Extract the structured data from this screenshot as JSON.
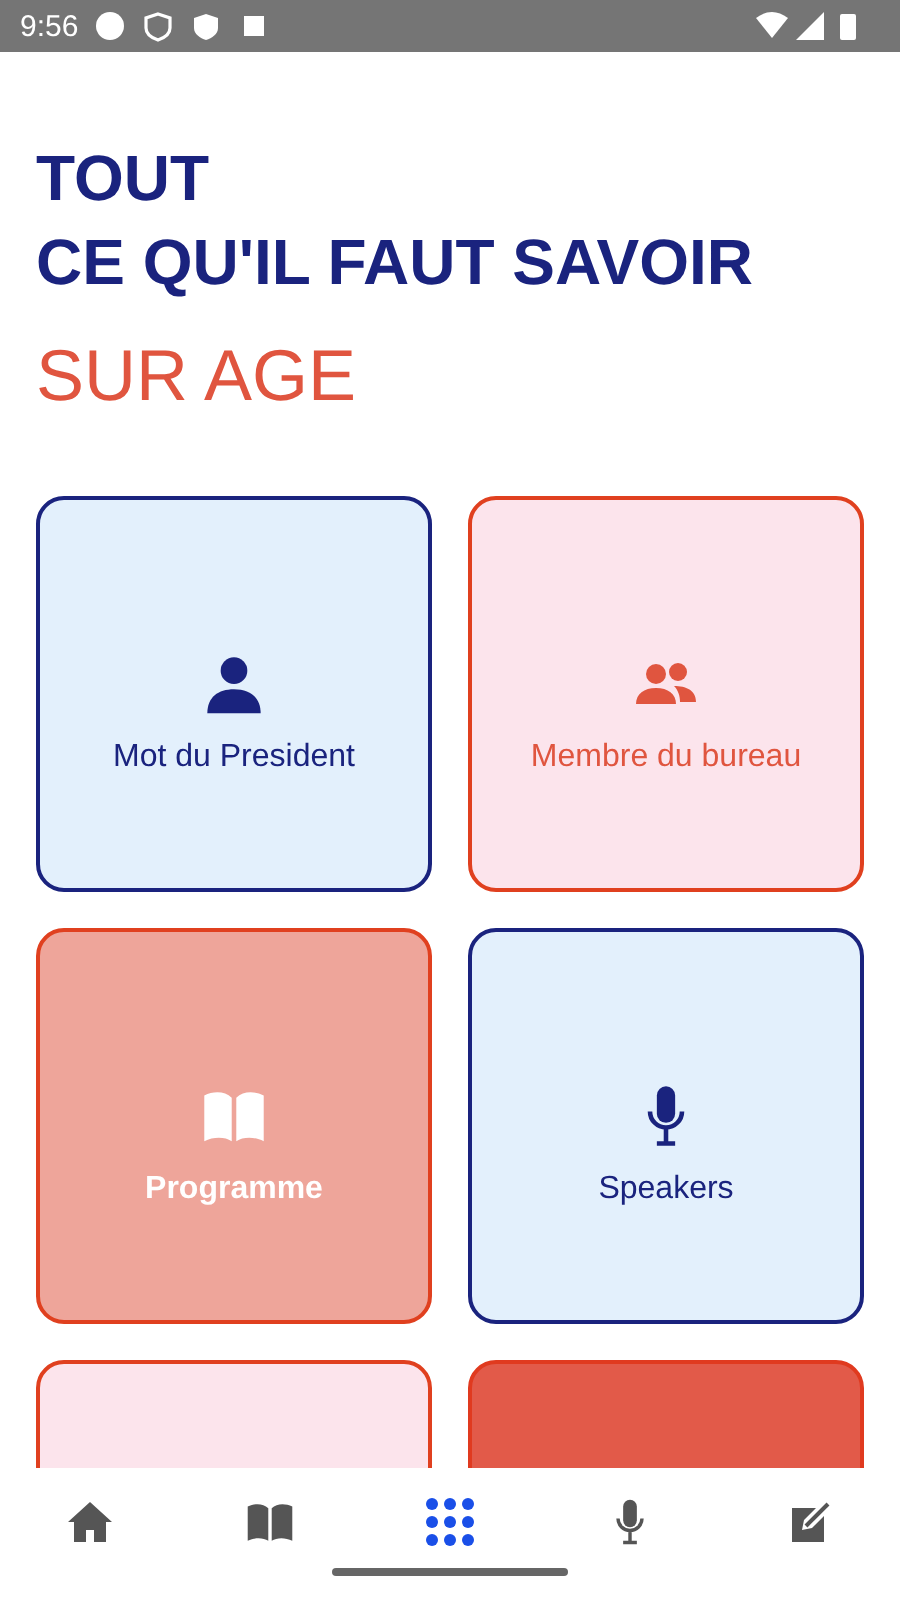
{
  "status_bar": {
    "time": "9:56"
  },
  "title": {
    "line_1": "TOUT",
    "line_2": "CE QU'IL FAUT SAVOIR",
    "subtitle": "SUR AGE"
  },
  "cards": [
    {
      "label": "Mot du President",
      "kind": "person"
    },
    {
      "label": "Membre du bureau",
      "kind": "people"
    },
    {
      "label": "Programme",
      "kind": "book"
    },
    {
      "label": "Speakers",
      "kind": "mic"
    },
    {
      "kind": "blank"
    },
    {
      "kind": "blank"
    }
  ],
  "nav": [
    {
      "kind": "home",
      "selected": false
    },
    {
      "kind": "book",
      "selected": false
    },
    {
      "kind": "grid",
      "selected": true
    },
    {
      "kind": "mic",
      "selected": false
    },
    {
      "kind": "edit",
      "selected": false
    }
  ]
}
